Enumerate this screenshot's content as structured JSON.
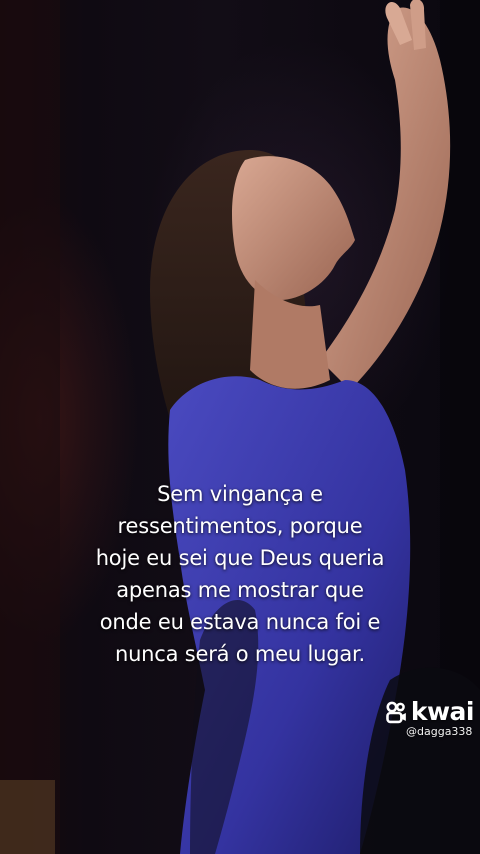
{
  "video": {
    "caption_lines": [
      "Sem vingança e",
      "ressentimentos, porque",
      "hoje eu sei que Deus queria",
      "apenas me mostrar que",
      "onde eu estava nunca foi e",
      "nunca será o meu lugar."
    ],
    "colors": {
      "dress": "#3b3aa8",
      "background": "#0e0a12",
      "caption_text": "#ffffff"
    }
  },
  "watermark": {
    "icon": "kwai-logo-icon",
    "brand": "kwai",
    "handle": "@dagga338"
  }
}
